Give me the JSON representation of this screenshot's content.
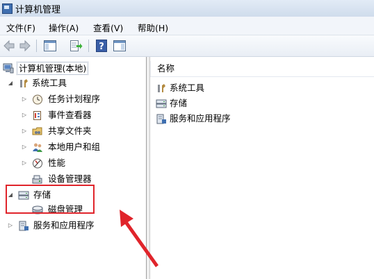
{
  "window": {
    "title": "计算机管理"
  },
  "menu": [
    {
      "label": "文件(F)"
    },
    {
      "label": "操作(A)"
    },
    {
      "label": "查看(V)"
    },
    {
      "label": "帮助(H)"
    }
  ],
  "toolbar": {
    "buttons": [
      "back-icon",
      "forward-icon",
      "show-hide-console-tree-icon",
      "export-list-icon",
      "help-icon",
      "show-hide-action-pane-icon"
    ]
  },
  "tree": {
    "root": "计算机管理(本地)",
    "system_tools": {
      "label": "系统工具",
      "children": [
        "任务计划程序",
        "事件查看器",
        "共享文件夹",
        "本地用户和组",
        "性能",
        "设备管理器"
      ]
    },
    "storage": {
      "label": "存储",
      "children": [
        "磁盘管理"
      ]
    },
    "services": "服务和应用程序"
  },
  "list": {
    "column_header": "名称",
    "items": [
      "系统工具",
      "存储",
      "服务和应用程序"
    ]
  },
  "colors": {
    "annotation": "#e0242b",
    "titlebar": "#cfdcec"
  }
}
